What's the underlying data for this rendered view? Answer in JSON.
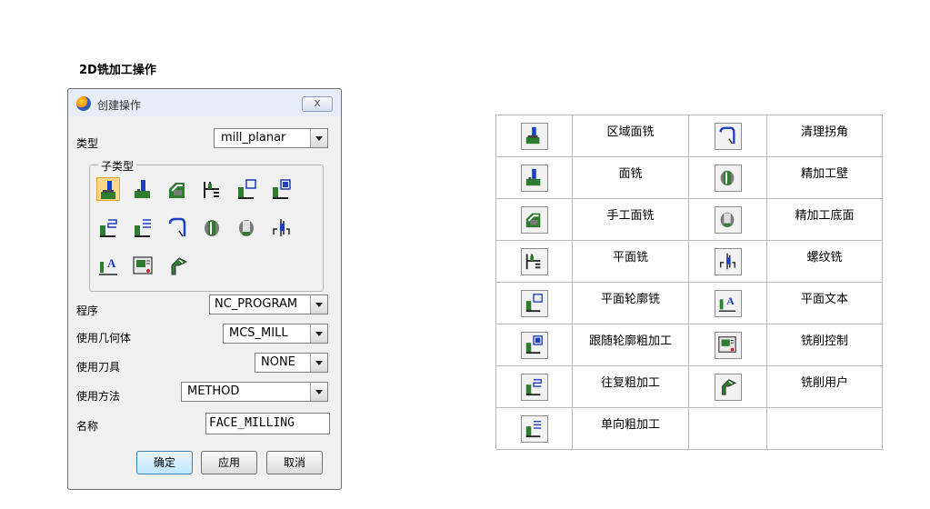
{
  "heading": "2D铣加工操作",
  "dialog": {
    "title": "创建操作",
    "close_label": "X",
    "type_label": "类型",
    "type_value": "mill_planar",
    "subtype_label": "子类型",
    "program_label": "程序",
    "program_value": "NC_PROGRAM",
    "geometry_label": "使用几何体",
    "geometry_value": "MCS_MILL",
    "tool_label": "使用刀具",
    "tool_value": "NONE",
    "method_label": "使用方法",
    "method_value": "METHOD",
    "name_label": "名称",
    "name_value": "FACE_MILLING",
    "ok_label": "确定",
    "apply_label": "应用",
    "cancel_label": "取消",
    "subtypes": [
      "face-milling-area-icon",
      "face-milling-icon",
      "face-milling-manual-icon",
      "planar-mill-icon",
      "planar-profile-icon",
      "follow-periphery-icon",
      "zig-zag-icon",
      "zig-icon",
      "cleanup-corners-icon",
      "finish-walls-icon",
      "finish-floor-icon",
      "thread-milling-icon",
      "planar-text-icon",
      "mill-control-icon",
      "mill-user-icon"
    ],
    "selected_subtype": "face-milling-area-icon"
  },
  "table": {
    "rows": [
      {
        "left_icon": "face-milling-area-icon",
        "left_name": "区域面铣",
        "right_icon": "cleanup-corners-icon",
        "right_name": "清理拐角"
      },
      {
        "left_icon": "face-milling-icon",
        "left_name": "面铣",
        "right_icon": "finish-walls-icon",
        "right_name": "精加工壁"
      },
      {
        "left_icon": "face-milling-manual-icon",
        "left_name": "手工面铣",
        "right_icon": "finish-floor-icon",
        "right_name": "精加工底面"
      },
      {
        "left_icon": "planar-mill-icon",
        "left_name": "平面铣",
        "right_icon": "thread-milling-icon",
        "right_name": "螺纹铣"
      },
      {
        "left_icon": "planar-profile-icon",
        "left_name": "平面轮廓铣",
        "right_icon": "planar-text-icon",
        "right_name": "平面文本"
      },
      {
        "left_icon": "follow-periphery-icon",
        "left_name": "跟随轮廓粗加工",
        "right_icon": "mill-control-icon",
        "right_name": "铣削控制"
      },
      {
        "left_icon": "zig-zag-icon",
        "left_name": "往复粗加工",
        "right_icon": "mill-user-icon",
        "right_name": "铣削用户"
      },
      {
        "left_icon": "zig-icon",
        "left_name": "单向粗加工",
        "right_icon": "",
        "right_name": ""
      }
    ]
  },
  "colors": {
    "selection": "#ffd78a",
    "icon_blue": "#1b3fbf",
    "icon_green": "#2e7d2e",
    "icon_gray": "#7a7a7a"
  }
}
